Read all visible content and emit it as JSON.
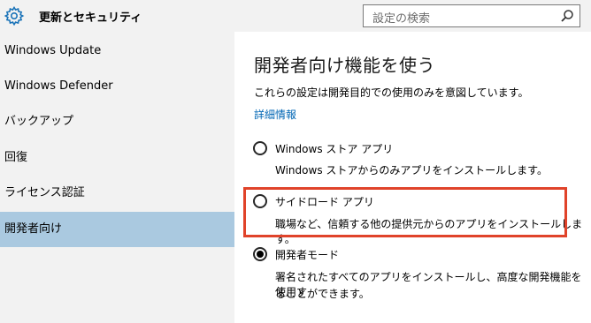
{
  "header": {
    "title": "更新とセキュリティ",
    "search_placeholder": "設定の検索"
  },
  "sidebar": {
    "items": [
      {
        "label": "Windows Update",
        "selected": false
      },
      {
        "label": "Windows Defender",
        "selected": false
      },
      {
        "label": "バックアップ",
        "selected": false
      },
      {
        "label": "回復",
        "selected": false
      },
      {
        "label": "ライセンス認証",
        "selected": false
      },
      {
        "label": "開発者向け",
        "selected": true
      }
    ]
  },
  "main": {
    "title": "開発者向け機能を使う",
    "description": "これらの設定は開発目的での使用のみを意図しています。",
    "details_link": "詳細情報",
    "options": [
      {
        "label": "Windows ストア アプリ",
        "description": "Windows ストアからのみアプリをインストールします。",
        "selected": false
      },
      {
        "label": "サイドロード アプリ",
        "description": "職場など、信頼する他の提供元からのアプリをインストールします。",
        "selected": false
      },
      {
        "label": "開発者モード",
        "description_line1": "署名されたすべてのアプリをインストールし、高度な開発機能を使用す",
        "description_line2": "ることができます。",
        "selected": true
      }
    ]
  },
  "colors": {
    "selected_nav": "#aac9e0",
    "link": "#0066b4",
    "highlight_border": "#e0432a"
  }
}
